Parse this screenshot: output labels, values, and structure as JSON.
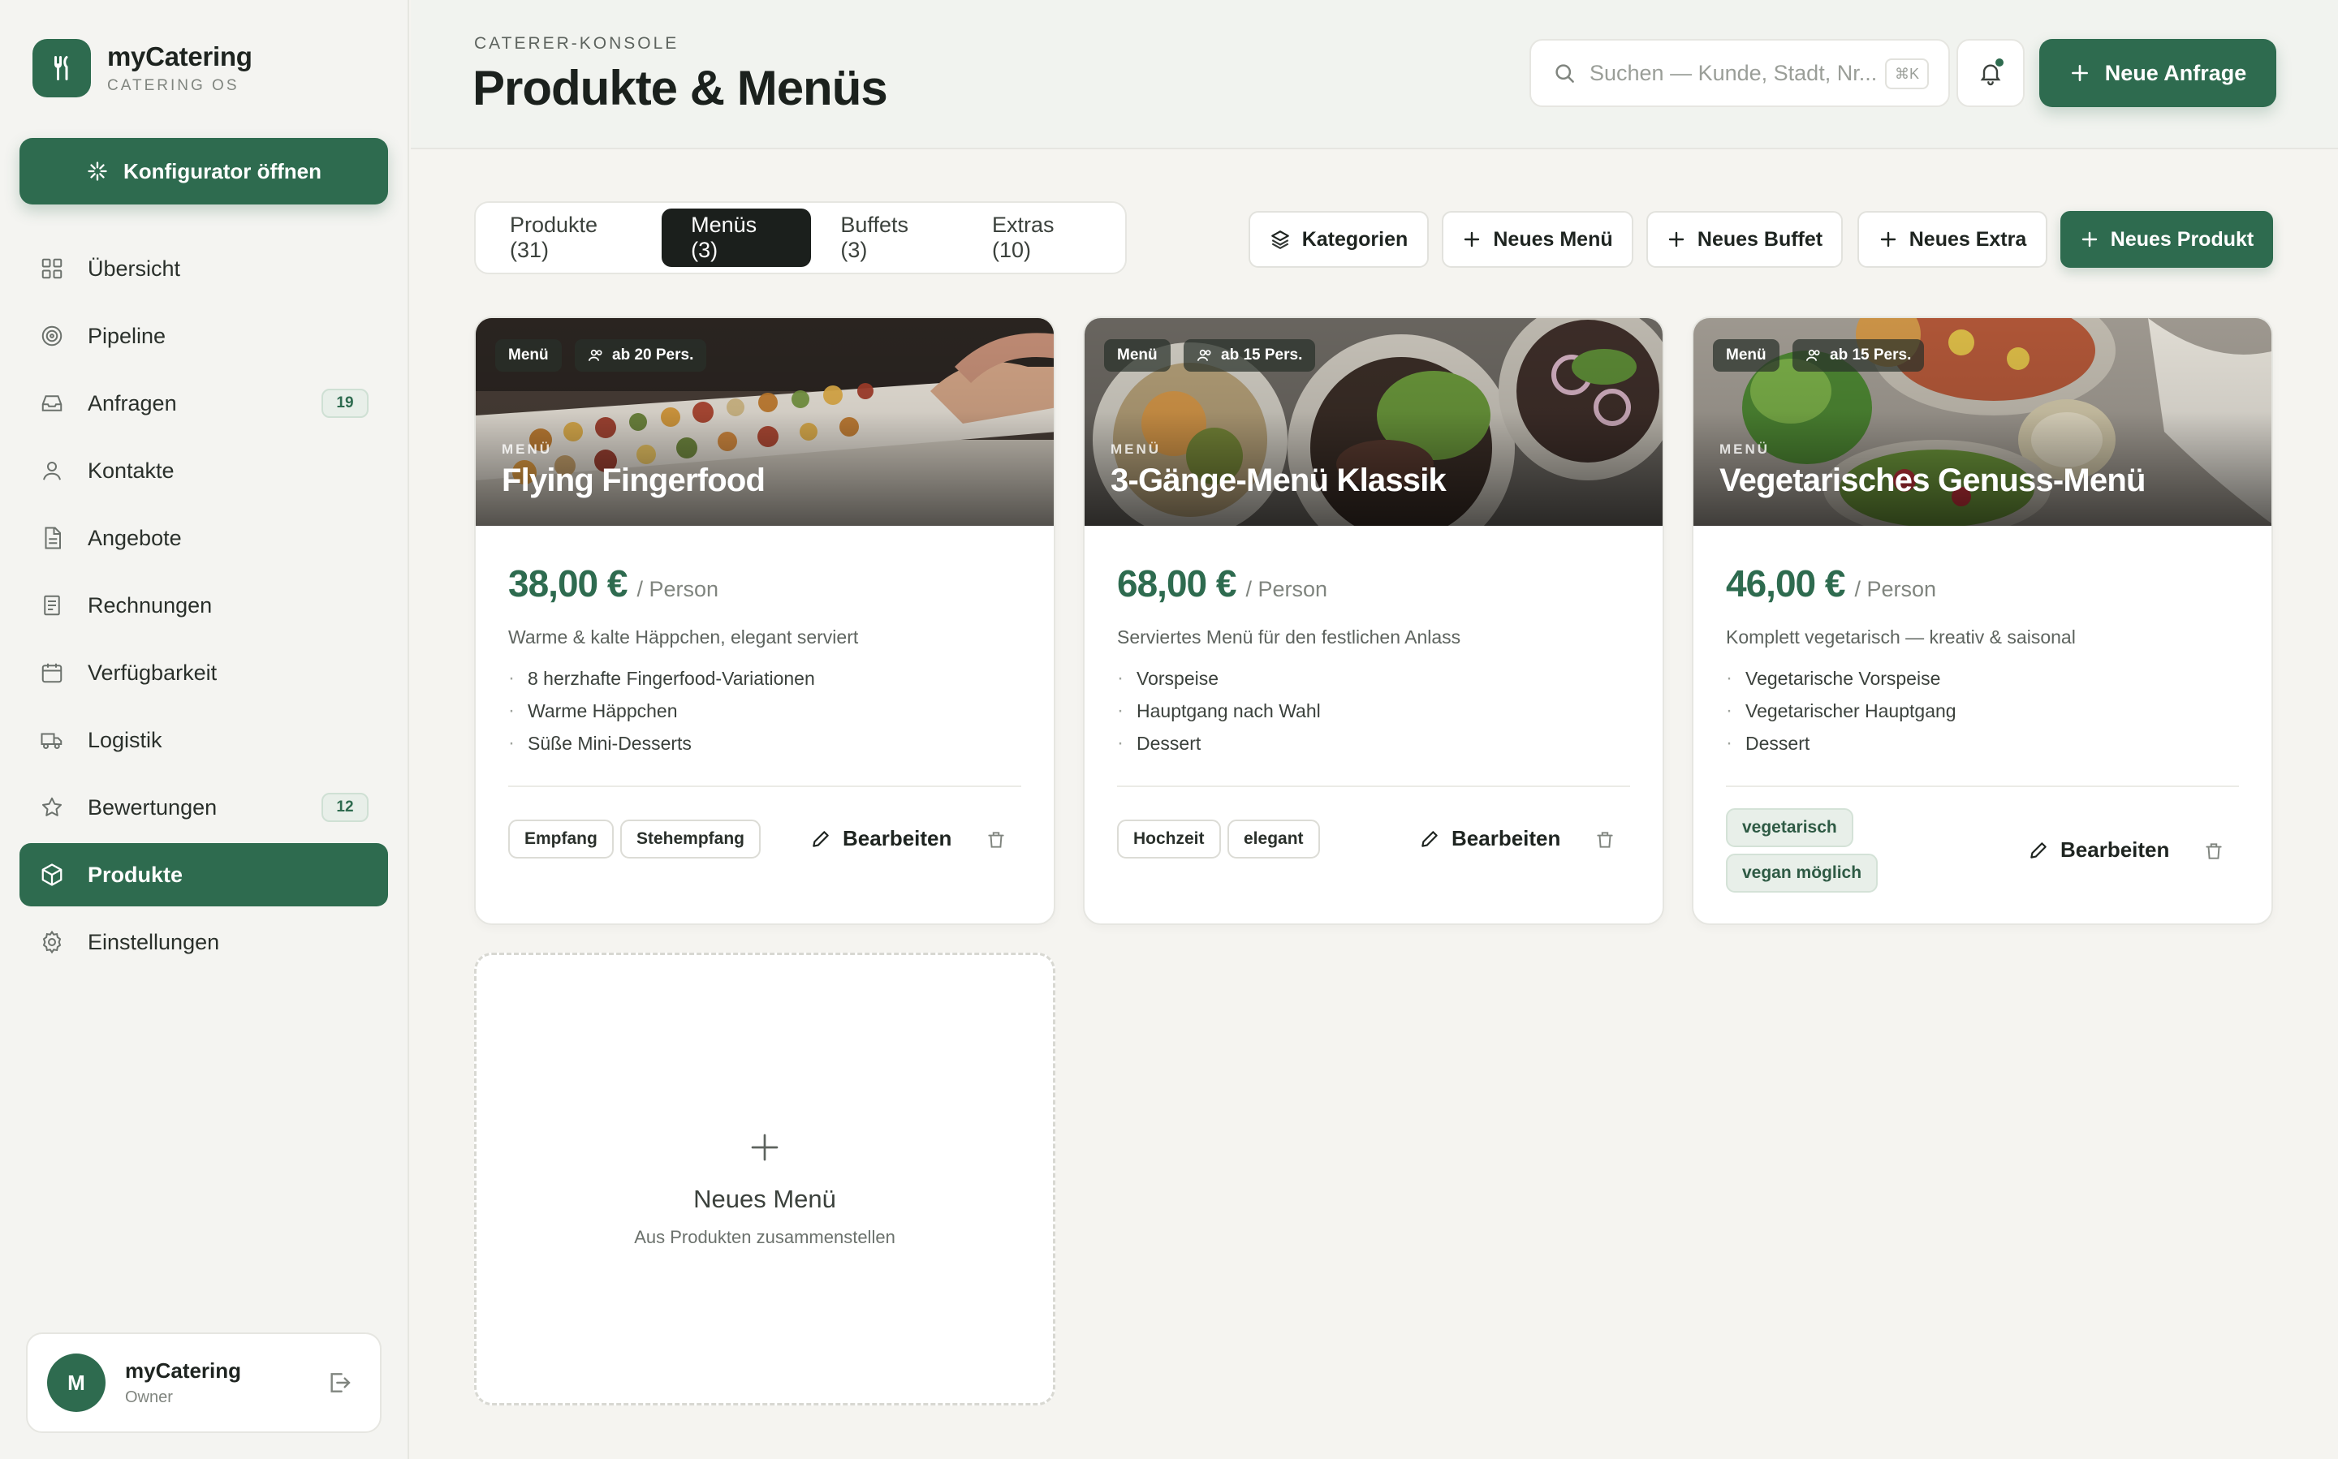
{
  "brand": {
    "name": "myCatering",
    "sub": "CATERING OS"
  },
  "sidebar": {
    "cta": "Konfigurator öffnen",
    "items": [
      {
        "label": "Übersicht",
        "icon": "dashboard-icon"
      },
      {
        "label": "Pipeline",
        "icon": "target-icon"
      },
      {
        "label": "Anfragen",
        "icon": "inbox-icon",
        "badge": "19"
      },
      {
        "label": "Kontakte",
        "icon": "user-icon"
      },
      {
        "label": "Angebote",
        "icon": "document-icon"
      },
      {
        "label": "Rechnungen",
        "icon": "receipt-icon"
      },
      {
        "label": "Verfügbarkeit",
        "icon": "calendar-icon"
      },
      {
        "label": "Logistik",
        "icon": "truck-icon"
      },
      {
        "label": "Bewertungen",
        "icon": "star-icon",
        "badge": "12"
      },
      {
        "label": "Produkte",
        "icon": "box-icon",
        "active": true
      },
      {
        "label": "Einstellungen",
        "icon": "gear-icon"
      }
    ],
    "user": {
      "initial": "M",
      "name": "myCatering",
      "role": "Owner"
    }
  },
  "header": {
    "eyebrow": "CATERER-KONSOLE",
    "title": "Produkte & Menüs",
    "search_placeholder": "Suchen — Kunde, Stadt, Nr...",
    "search_shortcut": "⌘K",
    "new_request": "Neue Anfrage"
  },
  "tabs": [
    {
      "label": "Produkte (31)"
    },
    {
      "label": "Menüs (3)",
      "active": true
    },
    {
      "label": "Buffets (3)"
    },
    {
      "label": "Extras (10)"
    }
  ],
  "toolbar": {
    "categories": "Kategorien",
    "new_menu": "Neues Menü",
    "new_buffet": "Neues Buffet",
    "new_extra": "Neues Extra",
    "new_product": "Neues Produkt"
  },
  "cards": [
    {
      "type_pill": "Menü",
      "persons": "ab 20 Pers.",
      "eyebrow": "MENÜ",
      "title": "Flying Fingerfood",
      "price": "38,00 €",
      "unit": "/ Person",
      "description": "Warme & kalte Häppchen, elegant serviert",
      "items": [
        "8 herzhafte Fingerfood-Variationen",
        "Warme Häppchen",
        "Süße Mini-Desserts"
      ],
      "tags": [
        "Empfang",
        "Stehempfang"
      ],
      "edit": "Bearbeiten"
    },
    {
      "type_pill": "Menü",
      "persons": "ab 15 Pers.",
      "eyebrow": "MENÜ",
      "title": "3-Gänge-Menü Klassik",
      "price": "68,00 €",
      "unit": "/ Person",
      "description": "Serviertes Menü für den festlichen Anlass",
      "items": [
        "Vorspeise",
        "Hauptgang nach Wahl",
        "Dessert"
      ],
      "tags": [
        "Hochzeit",
        "elegant"
      ],
      "edit": "Bearbeiten"
    },
    {
      "type_pill": "Menü",
      "persons": "ab 15 Pers.",
      "eyebrow": "MENÜ",
      "title": "Vegetarisches Genuss-Menü",
      "price": "46,00 €",
      "unit": "/ Person",
      "description": "Komplett vegetarisch — kreativ & saisonal",
      "items": [
        "Vegetarische Vorspeise",
        "Vegetarischer Hauptgang",
        "Dessert"
      ],
      "tags": [
        "vegetarisch",
        "vegan möglich"
      ],
      "edit": "Bearbeiten"
    }
  ],
  "new_card": {
    "title": "Neues Menü",
    "subtitle": "Aus Produkten zusammenstellen"
  },
  "colors": {
    "accent": "#2e6b4f",
    "dark": "#1b1f1c",
    "background": "#f5f4f0"
  }
}
